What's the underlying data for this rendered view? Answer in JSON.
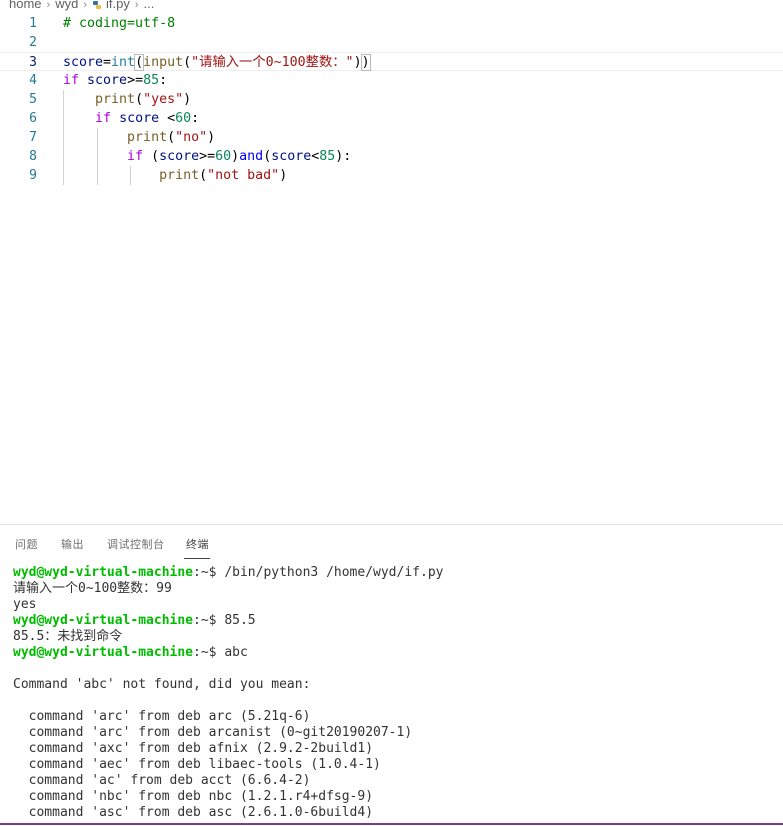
{
  "breadcrumb": {
    "items": [
      "home",
      "wyd",
      "if.py",
      "..."
    ]
  },
  "editor": {
    "line_numbers": [
      "1",
      "2",
      "3",
      "4",
      "5",
      "6",
      "7",
      "8",
      "9"
    ],
    "active_line": "3",
    "lines": [
      [
        {
          "t": "# coding=utf-8",
          "c": "com"
        }
      ],
      [],
      [
        {
          "t": "score",
          "c": "var"
        },
        {
          "t": "=",
          "c": "op"
        },
        {
          "t": "int",
          "c": "cls"
        },
        {
          "t": "(",
          "c": "op",
          "b": true
        },
        {
          "t": "input",
          "c": "fn"
        },
        {
          "t": "(",
          "c": "op"
        },
        {
          "t": "\"请输入一个0~100整数：\"",
          "c": "str"
        },
        {
          "t": ")",
          "c": "op"
        },
        {
          "t": ")",
          "c": "op",
          "b": true
        }
      ],
      [
        {
          "t": "if",
          "c": "kw"
        },
        {
          "t": " ",
          "c": "op"
        },
        {
          "t": "score",
          "c": "var"
        },
        {
          "t": ">=",
          "c": "op"
        },
        {
          "t": "85",
          "c": "num"
        },
        {
          "t": ":",
          "c": "op"
        }
      ],
      [
        {
          "t": "    ",
          "c": "op"
        },
        {
          "t": "print",
          "c": "fn"
        },
        {
          "t": "(",
          "c": "op"
        },
        {
          "t": "\"yes\"",
          "c": "str"
        },
        {
          "t": ")",
          "c": "op"
        }
      ],
      [
        {
          "t": "    ",
          "c": "op"
        },
        {
          "t": "if",
          "c": "kw"
        },
        {
          "t": " ",
          "c": "op"
        },
        {
          "t": "score",
          "c": "var"
        },
        {
          "t": " <",
          "c": "op"
        },
        {
          "t": "60",
          "c": "num"
        },
        {
          "t": ":",
          "c": "op"
        }
      ],
      [
        {
          "t": "        ",
          "c": "op"
        },
        {
          "t": "print",
          "c": "fn"
        },
        {
          "t": "(",
          "c": "op"
        },
        {
          "t": "\"no\"",
          "c": "str"
        },
        {
          "t": ")",
          "c": "op"
        }
      ],
      [
        {
          "t": "        ",
          "c": "op"
        },
        {
          "t": "if",
          "c": "kw"
        },
        {
          "t": " (",
          "c": "op"
        },
        {
          "t": "score",
          "c": "var"
        },
        {
          "t": ">=",
          "c": "op"
        },
        {
          "t": "60",
          "c": "num"
        },
        {
          "t": ")",
          "c": "op"
        },
        {
          "t": "and",
          "c": "kw2"
        },
        {
          "t": "(",
          "c": "op"
        },
        {
          "t": "score",
          "c": "var"
        },
        {
          "t": "<",
          "c": "op"
        },
        {
          "t": "85",
          "c": "num"
        },
        {
          "t": "):",
          "c": "op"
        }
      ],
      [
        {
          "t": "            ",
          "c": "op"
        },
        {
          "t": "print",
          "c": "fn"
        },
        {
          "t": "(",
          "c": "op"
        },
        {
          "t": "\"not bad\"",
          "c": "str"
        },
        {
          "t": ")",
          "c": "op"
        }
      ]
    ]
  },
  "panel": {
    "tabs": [
      {
        "label": "问题",
        "active": false
      },
      {
        "label": "输出",
        "active": false
      },
      {
        "label": "调试控制台",
        "active": false
      },
      {
        "label": "终端",
        "active": true
      }
    ]
  },
  "terminal": {
    "lines": [
      {
        "prompt": "wyd@wyd-virtual-machine",
        "rest": ":~$ /bin/python3 /home/wyd/if.py"
      },
      {
        "text": "请输入一个0~100整数：99"
      },
      {
        "text": "yes"
      },
      {
        "prompt": "wyd@wyd-virtual-machine",
        "rest": ":~$ 85.5"
      },
      {
        "text": "85.5：未找到命令"
      },
      {
        "prompt": "wyd@wyd-virtual-machine",
        "rest": ":~$ abc"
      },
      {
        "text": ""
      },
      {
        "text": "Command 'abc' not found, did you mean:"
      },
      {
        "text": ""
      },
      {
        "text": "  command 'arc' from deb arc (5.21q-6)"
      },
      {
        "text": "  command 'arc' from deb arcanist (0~git20190207-1)"
      },
      {
        "text": "  command 'axc' from deb afnix (2.9.2-2build1)"
      },
      {
        "text": "  command 'aec' from deb libaec-tools (1.0.4-1)"
      },
      {
        "text": "  command 'ac' from deb acct (6.6.4-2)"
      },
      {
        "text": "  command 'nbc' from deb nbc (1.2.1.r4+dfsg-9)"
      },
      {
        "text": "  command 'asc' from deb asc (2.6.1.0-6build4)"
      }
    ]
  },
  "colors": {
    "accent_bar": "#7b3b8f",
    "prompt": "#00bc00"
  }
}
